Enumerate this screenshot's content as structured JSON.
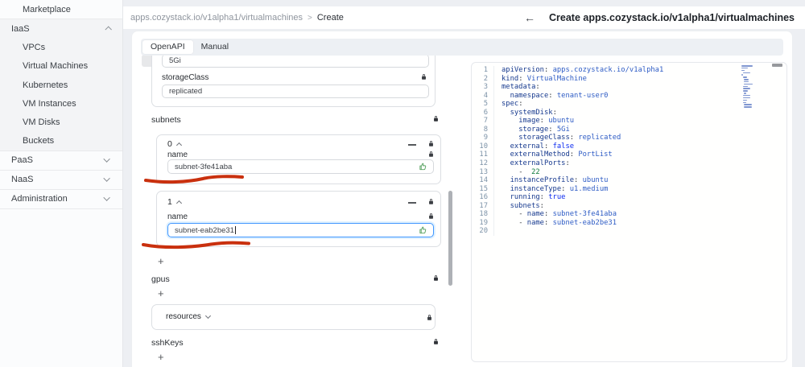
{
  "sidebar": {
    "top": [
      {
        "label": "Marketplace",
        "level": 1,
        "chevron": ""
      }
    ],
    "iaas": [
      {
        "label": "IaaS",
        "level": 0,
        "chevron": "up"
      },
      {
        "label": "VPCs",
        "level": 1,
        "chevron": ""
      },
      {
        "label": "Virtual Machines",
        "level": 1,
        "chevron": ""
      },
      {
        "label": "Kubernetes",
        "level": 1,
        "chevron": ""
      },
      {
        "label": "VM Instances",
        "level": 1,
        "chevron": ""
      },
      {
        "label": "VM Disks",
        "level": 1,
        "chevron": ""
      },
      {
        "label": "Buckets",
        "level": 1,
        "chevron": ""
      }
    ],
    "bottom": [
      {
        "label": "PaaS",
        "level": 0,
        "chevron": "down"
      },
      {
        "label": "NaaS",
        "level": 0,
        "chevron": "down"
      },
      {
        "label": "Administration",
        "level": 0,
        "chevron": "down"
      }
    ]
  },
  "toolbar": {
    "breadcrumb_path": "apps.cozystack.io/v1alpha1/virtualmachines",
    "breadcrumb_sep": ">",
    "breadcrumb_current": "Create",
    "back_icon": "←",
    "page_title": "Create apps.cozystack.io/v1alpha1/virtualmachines"
  },
  "tabs": [
    {
      "label": "OpenAPI",
      "active": true
    },
    {
      "label": "Manual",
      "active": false
    }
  ],
  "form": {
    "storage_value_partial": "5Gi",
    "storage_class": {
      "label": "storageClass",
      "value": "replicated"
    },
    "subnets_label": "subnets",
    "subnets": {
      "items": [
        {
          "index": "0",
          "name_label": "name",
          "value": "subnet-3fe41aba",
          "focused": false
        },
        {
          "index": "1",
          "name_label": "name",
          "value": "subnet-eab2be31",
          "focused": true
        }
      ]
    },
    "add_label": "+",
    "gpus_label": "gpus",
    "resources_label": "resources",
    "sshkeys_label": "sshKeys"
  },
  "editor": {
    "lines": [
      {
        "n": "1",
        "indent": 0,
        "dash": false,
        "key": "apiVersion",
        "value": "apps.cozystack.io/v1alpha1",
        "vtype": "str"
      },
      {
        "n": "2",
        "indent": 0,
        "dash": false,
        "key": "kind",
        "value": "VirtualMachine",
        "vtype": "str"
      },
      {
        "n": "3",
        "indent": 0,
        "dash": false,
        "key": "metadata",
        "value": "",
        "vtype": "none"
      },
      {
        "n": "4",
        "indent": 1,
        "dash": false,
        "key": "namespace",
        "value": "tenant-user0",
        "vtype": "str"
      },
      {
        "n": "5",
        "indent": 0,
        "dash": false,
        "key": "spec",
        "value": "",
        "vtype": "none"
      },
      {
        "n": "6",
        "indent": 1,
        "dash": false,
        "key": "systemDisk",
        "value": "",
        "vtype": "none"
      },
      {
        "n": "7",
        "indent": 2,
        "dash": false,
        "key": "image",
        "value": "ubuntu",
        "vtype": "str"
      },
      {
        "n": "8",
        "indent": 2,
        "dash": false,
        "key": "storage",
        "value": "5Gi",
        "vtype": "str"
      },
      {
        "n": "9",
        "indent": 2,
        "dash": false,
        "key": "storageClass",
        "value": "replicated",
        "vtype": "str"
      },
      {
        "n": "10",
        "indent": 1,
        "dash": false,
        "key": "external",
        "value": "false",
        "vtype": "bool"
      },
      {
        "n": "11",
        "indent": 1,
        "dash": false,
        "key": "externalMethod",
        "value": "PortList",
        "vtype": "str"
      },
      {
        "n": "12",
        "indent": 1,
        "dash": false,
        "key": "externalPorts",
        "value": "",
        "vtype": "none"
      },
      {
        "n": "13",
        "indent": 2,
        "dash": true,
        "key": "",
        "value": "22",
        "vtype": "num"
      },
      {
        "n": "14",
        "indent": 1,
        "dash": false,
        "key": "instanceProfile",
        "value": "ubuntu",
        "vtype": "str"
      },
      {
        "n": "15",
        "indent": 1,
        "dash": false,
        "key": "instanceType",
        "value": "u1.medium",
        "vtype": "str"
      },
      {
        "n": "16",
        "indent": 1,
        "dash": false,
        "key": "running",
        "value": "true",
        "vtype": "bool"
      },
      {
        "n": "17",
        "indent": 1,
        "dash": false,
        "key": "subnets",
        "value": "",
        "vtype": "none"
      },
      {
        "n": "18",
        "indent": 2,
        "dash": true,
        "key": "name",
        "value": "subnet-3fe41aba",
        "vtype": "str"
      },
      {
        "n": "19",
        "indent": 2,
        "dash": true,
        "key": "name",
        "value": "subnet-eab2be31",
        "vtype": "str"
      },
      {
        "n": "20",
        "indent": 0,
        "dash": false,
        "key": "",
        "value": "",
        "vtype": "none"
      }
    ]
  },
  "colors": {
    "accent_focus": "#4096ff",
    "annotation_red": "#c9300e",
    "thumb_green": "#55a05e"
  }
}
